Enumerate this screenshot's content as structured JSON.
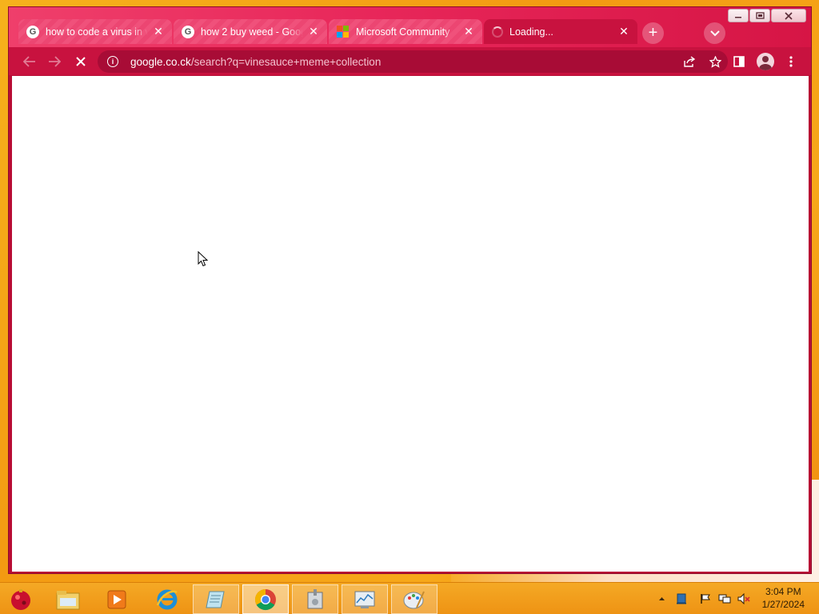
{
  "colors": {
    "window_frame": "#b80d35",
    "tab_strip": "#e8275a",
    "active_tab": "#c8123f",
    "omnibox": "#a80c36",
    "taskbar": "#f5a925",
    "desktop": "#f6b21c"
  },
  "window": {
    "caption": {
      "minimize_icon": "minimize-icon",
      "restore_icon": "restore-icon",
      "close_icon": "close-icon"
    }
  },
  "tabs": [
    {
      "title": "how to code a virus in v",
      "favicon": "google-icon",
      "close": "✕",
      "active": false
    },
    {
      "title": "how 2 buy weed - Goog",
      "favicon": "google-icon",
      "close": "✕",
      "active": false
    },
    {
      "title": "Microsoft Community",
      "favicon": "microsoft-logo-icon",
      "close": "✕",
      "active": false
    },
    {
      "title": "Loading...",
      "favicon": "loading-spinner-icon",
      "close": "✕",
      "active": true
    }
  ],
  "toolbar": {
    "back_icon": "back-arrow-icon",
    "forward_icon": "forward-arrow-icon",
    "stop_icon": "stop-loading-icon",
    "url_host": "google.co.ck",
    "url_path": "/search?q=vinesauce+meme+collection",
    "share_icon": "share-icon",
    "bookmark_icon": "star-icon",
    "side_panel_icon": "side-panel-icon",
    "profile_icon": "profile-avatar-icon",
    "menu_icon": "kebab-menu-icon"
  },
  "taskbar": {
    "apps": [
      {
        "name": "start-orb-icon"
      },
      {
        "name": "file-explorer-icon"
      },
      {
        "name": "media-player-icon"
      },
      {
        "name": "internet-explorer-icon"
      },
      {
        "name": "notepad-icon"
      },
      {
        "name": "chrome-icon"
      },
      {
        "name": "vault-app-icon"
      },
      {
        "name": "task-manager-icon"
      },
      {
        "name": "paint-icon"
      }
    ],
    "tray": [
      "show-hidden-icons-chevron",
      "display-icon",
      "action-center-flag-icon",
      "network-icon",
      "volume-muted-icon"
    ],
    "clock": {
      "time": "3:04 PM",
      "date": "1/27/2024"
    }
  }
}
